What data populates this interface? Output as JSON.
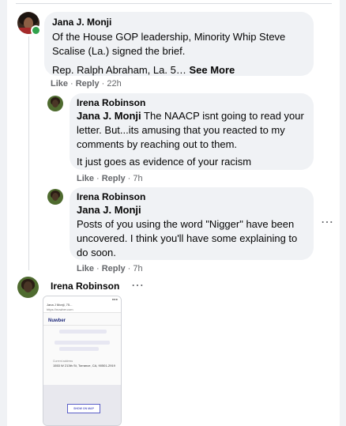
{
  "comments": [
    {
      "author": "Jana J. Monji",
      "lines": [
        "Of the House GOP leadership, Minority Whip Steve Scalise (La.) signed the brief.",
        "Rep. Ralph Abraham, La. 5…"
      ],
      "see_more": "See More",
      "like": "Like",
      "reply": "Reply",
      "time": "22h",
      "online": true
    }
  ],
  "replies": [
    {
      "author": "Irena Robinson",
      "mention": "Jana J. Monji",
      "text": "The NAACP isnt going to read your letter. But...its amusing that you reacted to my comments by reaching out to them.",
      "text2": "It just goes as evidence of your racism",
      "like": "Like",
      "reply": "Reply",
      "time": "7h"
    },
    {
      "author": "Irena Robinson",
      "mention": "Jana J. Monji",
      "text": "Posts of you using the word \"Nigger\" have been uncovered. I think you'll have some explaining to do soon.",
      "like": "Like",
      "reply": "Reply",
      "time": "7h"
    }
  ],
  "image_comment": {
    "author": "Irena Robinson",
    "more_icon": "ellipsis-icon",
    "screenshot": {
      "tab_title": "Jana J Monji, 75...",
      "url": "https://nuwber.com",
      "brand": "Nuwber",
      "address_label": "Current address",
      "address": "1553 W 213th St, Torrance, CA, 90501-2919",
      "map_button": "SHOW ON MAP"
    }
  },
  "separator": "·",
  "colors": {
    "bubble": "#f0f2f5",
    "meta": "#65676b",
    "online": "#31a24c"
  }
}
